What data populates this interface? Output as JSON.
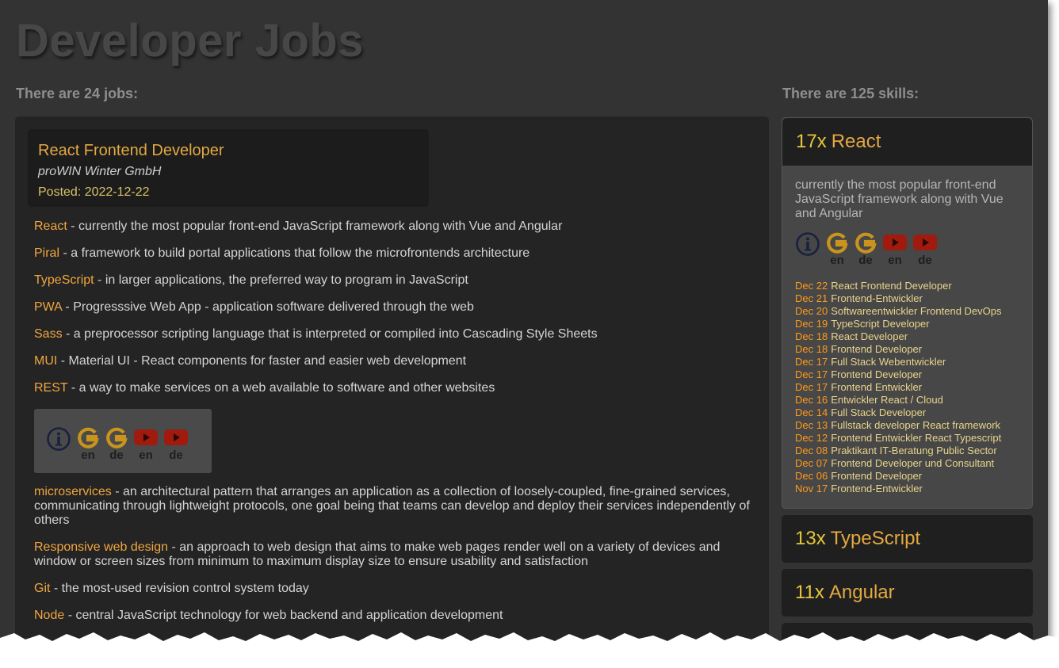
{
  "page_title": "Developer Jobs",
  "jobs_count_text": "There are 24 jobs:",
  "skills_count_text": "There are 125 skills:",
  "job": {
    "title": "React Frontend Developer",
    "company": "proWIN Winter GmbH",
    "posted": "Posted: 2022-12-22"
  },
  "job_skills": [
    {
      "name": "React",
      "desc": " - currently the most popular front-end JavaScript framework along with Vue and Angular"
    },
    {
      "name": "Piral",
      "desc": " - a framework to build portal applications that follow the microfrontends architecture"
    },
    {
      "name": "TypeScript",
      "desc": " - in larger applications, the preferred way to program in JavaScript"
    },
    {
      "name": "PWA",
      "desc": " - Progresssive Web App - application software delivered through the web"
    },
    {
      "name": "Sass",
      "desc": " - a preprocessor scripting language that is interpreted or compiled into Cascading Style Sheets"
    },
    {
      "name": "MUI",
      "desc": " - Material UI - React components for faster and easier web development"
    },
    {
      "name": "REST",
      "desc": " - a way to make services on a web available to software and other websites"
    },
    {
      "name": "microservices",
      "desc": " - an architectural pattern that arranges an application as a collection of loosely-coupled, fine-grained services, communicating through lightweight protocols, one goal being that teams can develop and deploy their services independently of others"
    },
    {
      "name": "Responsive web design",
      "desc": " - an approach to web design that aims to make web pages render well on a variety of devices and window or screen sizes from minimum to maximum display size to ensure usability and satisfaction"
    },
    {
      "name": "Git",
      "desc": " - the most-used revision control system today"
    },
    {
      "name": "Node",
      "desc": " - central JavaScript technology for web backend and application development"
    }
  ],
  "ref_links": {
    "info_icon": "info-icon",
    "labels": [
      "en",
      "de",
      "en",
      "de"
    ]
  },
  "skills_sidebar": {
    "expanded": {
      "count": "17x",
      "name": "React",
      "desc": "currently the most popular front-end JavaScript framework along with Vue and Angular",
      "jobs": [
        {
          "date": "Dec 22",
          "title": "React Frontend Developer"
        },
        {
          "date": "Dec 21",
          "title": "Frontend-Entwickler"
        },
        {
          "date": "Dec 20",
          "title": "Softwareentwickler Frontend DevOps"
        },
        {
          "date": "Dec 19",
          "title": "TypeScript Developer"
        },
        {
          "date": "Dec 18",
          "title": "React Developer"
        },
        {
          "date": "Dec 18",
          "title": "Frontend Developer"
        },
        {
          "date": "Dec 17",
          "title": "Full Stack Webentwickler"
        },
        {
          "date": "Dec 17",
          "title": "Frontend Developer"
        },
        {
          "date": "Dec 17",
          "title": "Frontend Entwickler"
        },
        {
          "date": "Dec 16",
          "title": "Entwickler React / Cloud"
        },
        {
          "date": "Dec 14",
          "title": "Full Stack Developer"
        },
        {
          "date": "Dec 13",
          "title": "Fullstack developer React framework"
        },
        {
          "date": "Dec 12",
          "title": "Frontend Entwickler React Typescript"
        },
        {
          "date": "Dec 08",
          "title": "Praktikant IT-Beratung Public Sector"
        },
        {
          "date": "Dec 07",
          "title": "Frontend Developer und Consultant"
        },
        {
          "date": "Dec 06",
          "title": "Frontend Developer"
        },
        {
          "date": "Nov 17",
          "title": "Frontend-Entwickler"
        }
      ]
    },
    "collapsed": [
      {
        "count": "13x",
        "name": "TypeScript"
      },
      {
        "count": "11x",
        "name": "Angular"
      }
    ]
  },
  "colors": {
    "background": "#333333",
    "panel": "#242424",
    "accent_orange": "#f0a640",
    "accent_yellow": "#e8c63a",
    "google_gold": "#c8941e",
    "youtube_red": "#a11a0e",
    "info_navy": "#1b2040"
  }
}
